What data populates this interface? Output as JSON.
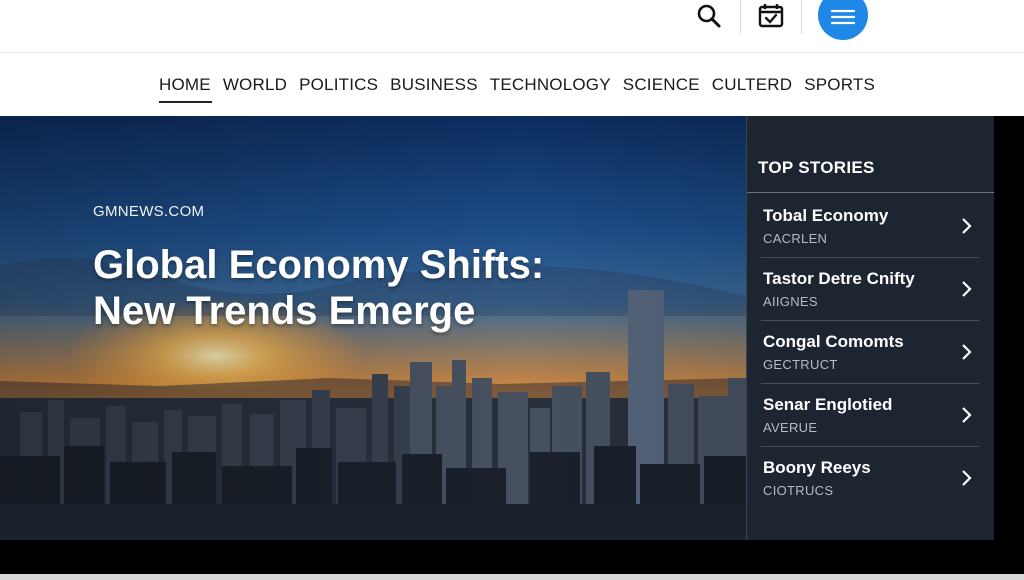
{
  "toolbar": {
    "search_icon": "search-icon",
    "calendar_icon": "calendar-check-icon",
    "menu_icon": "hamburger-menu-icon",
    "accent_color": "#1f87e5"
  },
  "nav": {
    "items": [
      "HOME",
      "WORLD",
      "POLITICS",
      "BUSINESS",
      "TECHNOLOGY",
      "SCIENCE",
      "CULTERD",
      "SPORTS"
    ],
    "active": "HOME"
  },
  "hero": {
    "source": "GMNEWS.COM",
    "headline_line1": "Global Economy Shifts:",
    "headline_line2": "New Trends Emerge"
  },
  "sidebar": {
    "title": "TOP STORIES",
    "stories": [
      {
        "title": "Tobal Economy",
        "subtitle": "CACRLEN"
      },
      {
        "title": "Tastor Detre Cnifty",
        "subtitle": "AIIGNES"
      },
      {
        "title": "Congal Comomts",
        "subtitle": "GECTRUCT"
      },
      {
        "title": "Senar Englotied",
        "subtitle": "AVERUE"
      },
      {
        "title": "Boony Reeys",
        "subtitle": "CIOTRUCS"
      }
    ]
  }
}
